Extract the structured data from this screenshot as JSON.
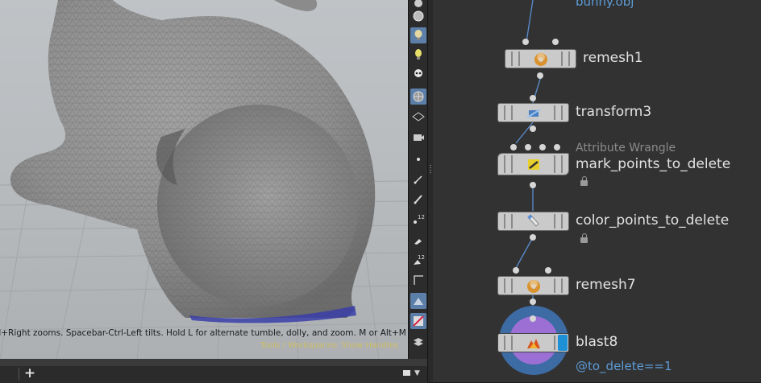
{
  "viewport": {
    "hint_text": "rl+Right zooms. Spacebar-Ctrl-Left tilts. Hold L for alternate tumble, dolly, and zoom.    M or Alt+M for",
    "sub_hint": "Tools / Workspaces: Show Handles",
    "add_tab_label": "+"
  },
  "toolbar": {
    "buttons": [
      "display-options-icon",
      "lighting-icon",
      "headlight-icon",
      "ghost-icon",
      "wireframe-shaded-icon",
      "visibility-icon",
      "camera-icon",
      "point-icon",
      "vector-icon",
      "normal-icon",
      "point-number-icon",
      "brush-icon",
      "primitive-number-icon",
      "uv-icon",
      "shading-mode-icon",
      "background-icon",
      "layers-icon"
    ]
  },
  "network": {
    "top_info": "bunny.obj",
    "nodes": [
      {
        "name": "remesh1",
        "icon": "donut-icon"
      },
      {
        "name": "transform3",
        "icon": "transform-icon"
      },
      {
        "name": "mark_points_to_delete",
        "type": "Attribute Wrangle",
        "icon": "wrangle-icon",
        "locked": true
      },
      {
        "name": "color_points_to_delete",
        "icon": "paint-tube-icon",
        "locked": true
      },
      {
        "name": "remesh7",
        "icon": "donut-icon"
      },
      {
        "name": "blast8",
        "icon": "blast-icon",
        "info": "@to_delete==1",
        "display_flag_color": "#1e90d6"
      }
    ]
  },
  "colors": {
    "selection_ring": "#3d6ba3",
    "selection_inner": "#9b6fd3",
    "active_tool": "#5b7fa8",
    "info_text": "#5d9bd7"
  }
}
